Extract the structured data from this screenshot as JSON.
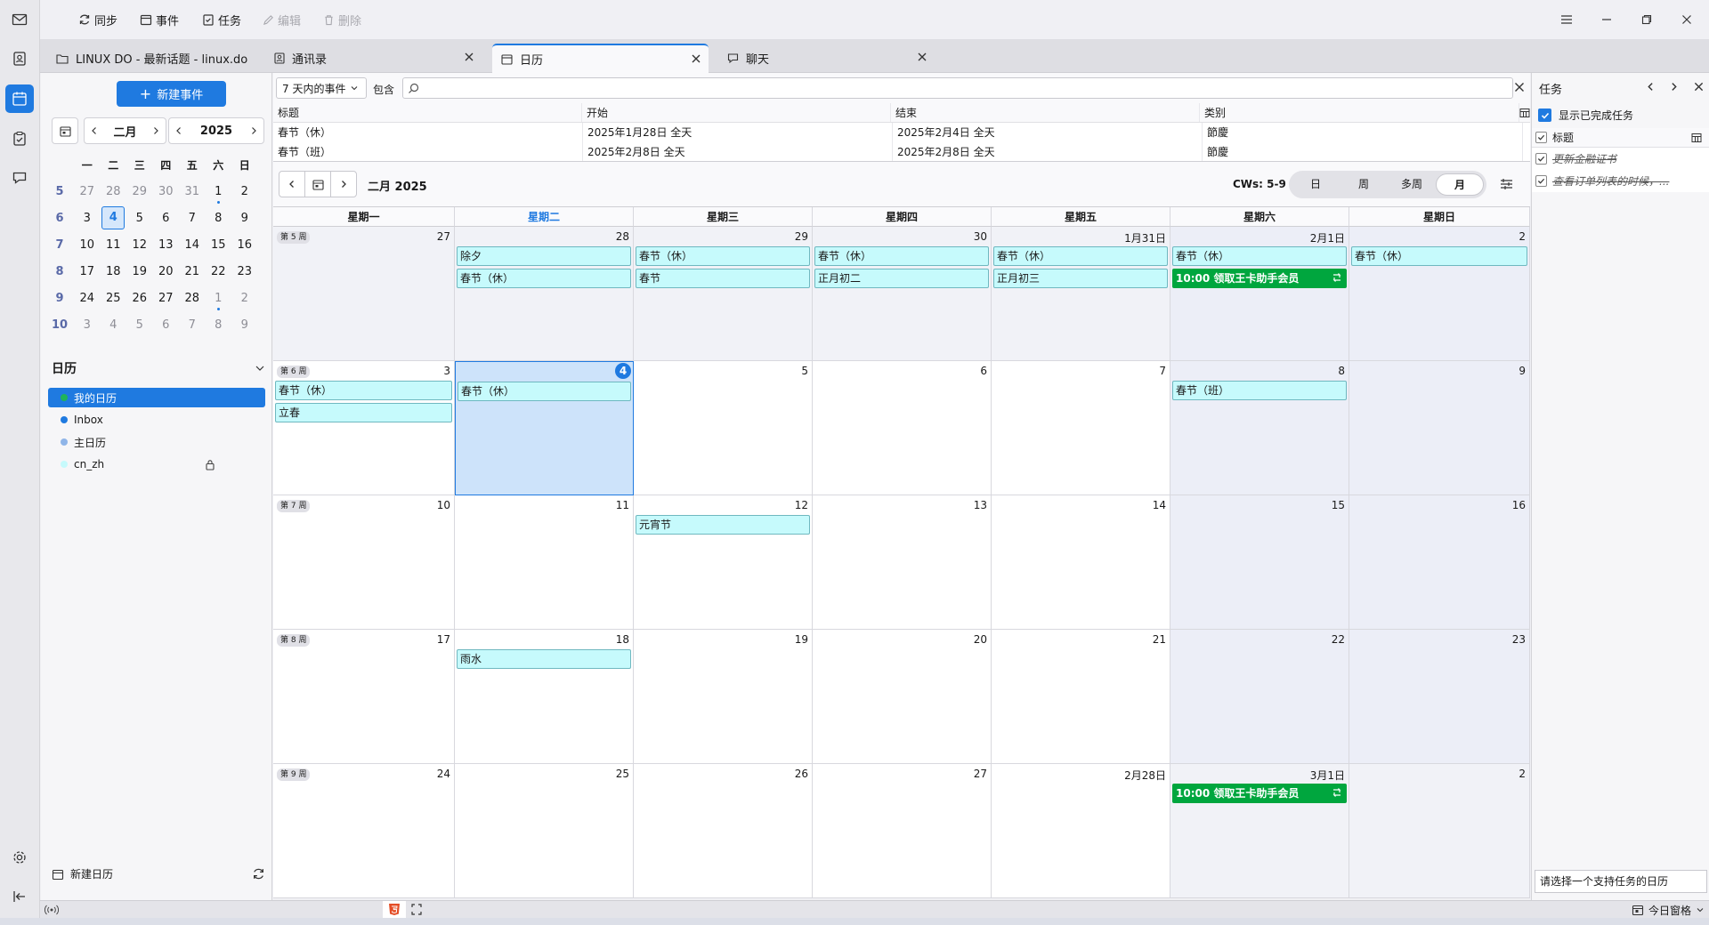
{
  "toolbar": {
    "sync": "同步",
    "event": "事件",
    "task": "任务",
    "edit": "编辑",
    "delete": "删除"
  },
  "tabs": [
    {
      "label": "LINUX DO - 最新话题 - linux.do"
    },
    {
      "label": "通讯录"
    },
    {
      "label": "日历"
    },
    {
      "label": "聊天"
    }
  ],
  "left": {
    "new_event": "新建事件",
    "month": "二月",
    "year": "2025",
    "weekday_headers": [
      "一",
      "二",
      "三",
      "四",
      "五",
      "六",
      "日"
    ],
    "weeks": [
      {
        "wk": "5",
        "days": [
          "27",
          "28",
          "29",
          "30",
          "31",
          "1",
          "2"
        ]
      },
      {
        "wk": "6",
        "days": [
          "3",
          "4",
          "5",
          "6",
          "7",
          "8",
          "9"
        ]
      },
      {
        "wk": "7",
        "days": [
          "10",
          "11",
          "12",
          "13",
          "14",
          "15",
          "16"
        ]
      },
      {
        "wk": "8",
        "days": [
          "17",
          "18",
          "19",
          "20",
          "21",
          "22",
          "23"
        ]
      },
      {
        "wk": "9",
        "days": [
          "24",
          "25",
          "26",
          "27",
          "28",
          "1",
          "2"
        ]
      },
      {
        "wk": "10",
        "days": [
          "3",
          "4",
          "5",
          "6",
          "7",
          "8",
          "9"
        ]
      }
    ],
    "calendars_header": "日历",
    "calendars": [
      {
        "name": "我的日历",
        "color": "#1fb35a"
      },
      {
        "name": "Inbox",
        "color": "#1f7ae0"
      },
      {
        "name": "主日历",
        "color": "#8fb5e8"
      },
      {
        "name": "cn_zh",
        "color": "#c6fafc"
      }
    ],
    "new_calendar": "新建日历"
  },
  "filter": {
    "range": "7 天内的事件",
    "contains": "包含",
    "search_placeholder": ""
  },
  "event_list": {
    "columns": [
      "标题",
      "开始",
      "结束",
      "类别"
    ],
    "rows": [
      [
        "春节（休）",
        "2025年1月28日 全天",
        "2025年2月4日 全天",
        "節慶"
      ],
      [
        "春节（班）",
        "2025年2月8日 全天",
        "2025年2月8日 全天",
        "節慶"
      ]
    ]
  },
  "month_view": {
    "title": "二月 2025",
    "cws": "CWs: 5-9",
    "views": [
      "日",
      "周",
      "多周",
      "月"
    ],
    "weekdays": [
      "星期一",
      "星期二",
      "星期三",
      "星期四",
      "星期五",
      "星期六",
      "星期日"
    ],
    "weeks": [
      {
        "badge": "第 5 周",
        "days": [
          "27",
          "28",
          "29",
          "30",
          "1月31日",
          "2月1日",
          "2"
        ]
      },
      {
        "badge": "第 6 周",
        "days": [
          "3",
          "4",
          "5",
          "6",
          "7",
          "8",
          "9"
        ]
      },
      {
        "badge": "第 7 周",
        "days": [
          "10",
          "11",
          "12",
          "13",
          "14",
          "15",
          "16"
        ]
      },
      {
        "badge": "第 8 周",
        "days": [
          "17",
          "18",
          "19",
          "20",
          "21",
          "22",
          "23"
        ]
      },
      {
        "badge": "第 9 周",
        "days": [
          "24",
          "25",
          "26",
          "27",
          "2月28日",
          "3月1日",
          "2"
        ]
      }
    ],
    "events": {
      "w0d1a": "除夕",
      "w0d1b": "春节（休）",
      "w0d2a": "春节（休）",
      "w0d2b": "春节",
      "w0d3a": "春节（休）",
      "w0d3b": "正月初二",
      "w0d4a": "春节（休）",
      "w0d4b": "正月初三",
      "w0d5a": "春节（休）",
      "w0d5b": "10:00 领取王卡助手会员",
      "w0d6a": "春节（休）",
      "w1d0a": "春节（休）",
      "w1d0b": "立春",
      "w1d1a": "春节（休）",
      "w1d5a": "春节（班）",
      "w2d2a": "元宵节",
      "w3d1a": "雨水",
      "w4d5a": "10:00 领取王卡助手会员"
    }
  },
  "tasks": {
    "title": "任务",
    "show_completed": "显示已完成任务",
    "column": "标题",
    "items": [
      "更新金融证书",
      "查看订单列表的时候，..."
    ],
    "input_placeholder": "请选择一个支持任务的日历"
  },
  "status": {
    "today_pane": "今日窗格"
  }
}
